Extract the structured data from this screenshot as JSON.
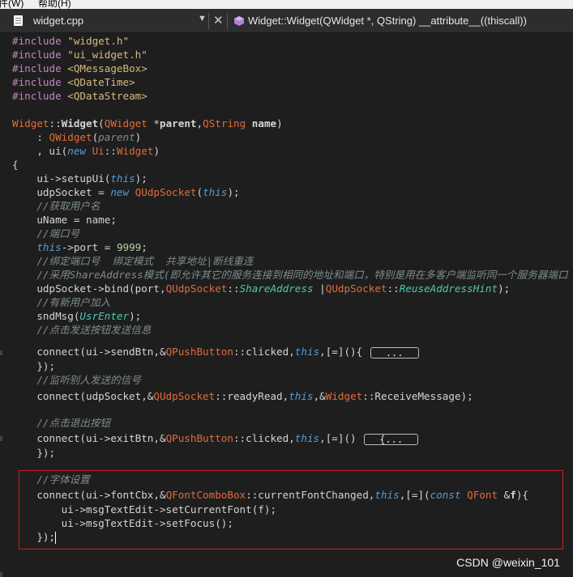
{
  "menubar": {
    "item1": "件(W)",
    "item2": "帮助(H)"
  },
  "tab": {
    "file_name": "widget.cpp",
    "dropdown_glyph": "▼",
    "close_glyph": "✕",
    "function_label": "Widget::Widget(QWidget *, QString) __attribute__((thiscall))"
  },
  "code": {
    "l1_a": "#include ",
    "l1_b": "\"widget.h\"",
    "l2_a": "#include ",
    "l2_b": "\"ui_widget.h\"",
    "l3_a": "#include ",
    "l3_b": "<QMessageBox>",
    "l4_a": "#include ",
    "l4_b": "<QDateTime>",
    "l5_a": "#include ",
    "l5_b": "<QDataStream>",
    "l7_cls": "Widget",
    "l7_sep": "::",
    "l7_fn": "Widget",
    "l7_p1": "(",
    "l7_t1": "QWidget",
    "l7_p2": " *",
    "l7_a1": "parent",
    "l7_p3": ",",
    "l7_t2": "QString",
    "l7_p4": " ",
    "l7_a2": "name",
    "l7_p5": ")",
    "l8_a": "    : ",
    "l8_b": "QWidget",
    "l8_c": "(",
    "l8_d": "parent",
    "l8_e": ")",
    "l9_a": "    , ui(",
    "l9_b": "new",
    "l9_c": " ",
    "l9_d": "Ui",
    "l9_e": "::",
    "l9_f": "Widget",
    "l9_g": ")",
    "l10": "{",
    "l11_a": "    ui->setupUi(",
    "l11_b": "this",
    "l11_c": ");",
    "l12_a": "    udpSocket = ",
    "l12_b": "new",
    "l12_c": " ",
    "l12_d": "QUdpSocket",
    "l12_e": "(",
    "l12_f": "this",
    "l12_g": ");",
    "l13": "    //获取用户名",
    "l14": "    uName = name;",
    "l15": "    //端口号",
    "l16_a": "    ",
    "l16_b": "this",
    "l16_c": "->port = ",
    "l16_d": "9999",
    "l16_e": ";",
    "l17": "    //绑定端口号  绑定模式  共享地址|断线重连",
    "l18": "    //采用ShareAddress模式(即允许其它的服务连接到相同的地址和端口，特别是用在多客户端监听同一个服务器端口",
    "l19_a": "    udpSocket->bind(port,",
    "l19_b": "QUdpSocket",
    "l19_c": "::",
    "l19_d": "ShareAddress",
    "l19_e": " |",
    "l19_f": "QUdpSocket",
    "l19_g": "::",
    "l19_h": "ReuseAddressHint",
    "l19_i": ");",
    "l20": "    //有新用户加入",
    "l21_a": "    sndMsg(",
    "l21_b": "UsrEnter",
    "l21_c": ");",
    "l22": "    //点击发送按钮发送信息",
    "l23_a": "    connect(ui->sendBtn,&",
    "l23_b": "QPushButton",
    "l23_c": "::clicked,",
    "l23_d": "this",
    "l23_e": ",[=](){ ",
    "l23_f": "...",
    "l24": "    });",
    "l25": "    //监听别人发送的信号",
    "l26_a": "    connect(udpSocket,&",
    "l26_b": "QUdpSocket",
    "l26_c": "::readyRead,",
    "l26_d": "this",
    "l26_e": ",&",
    "l26_f": "Widget",
    "l26_g": "::ReceiveMessage);",
    "l28": "    //点击退出按钮",
    "l29_a": "    connect(ui->exitBtn,&",
    "l29_b": "QPushButton",
    "l29_c": "::clicked,",
    "l29_d": "this",
    "l29_e": ",[=]() ",
    "l29_f": "{...",
    "l30": "    });",
    "l32": "    //字体设置",
    "l33_a": "    connect(ui->fontCbx,&",
    "l33_b": "QFontComboBox",
    "l33_c": "::currentFontChanged,",
    "l33_d": "this",
    "l33_e": ",[=](",
    "l33_f": "const",
    "l33_g": " ",
    "l33_h": "QFont",
    "l33_i": " &",
    "l33_j": "f",
    "l33_k": "){",
    "l34": "        ui->msgTextEdit->setCurrentFont(f);",
    "l35": "        ui->msgTextEdit->setFocus();",
    "l36": "    });"
  },
  "watermark": "CSDN @weixin_101",
  "colors": {
    "background": "#1e1e1e",
    "preprocessor": "#c586c0",
    "include_path": "#d7ba7d",
    "type": "#cc6633",
    "keyword": "#569cd6",
    "highlight_border": "#d02020"
  }
}
